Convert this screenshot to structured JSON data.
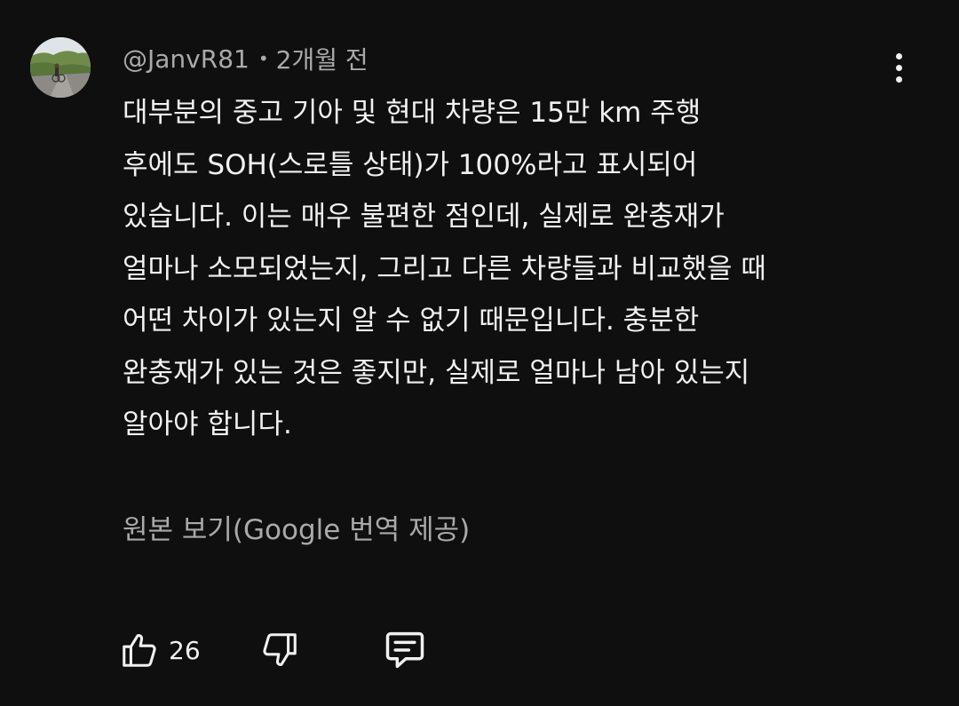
{
  "comment": {
    "author": "@JanvR81",
    "separator": "•",
    "time": "2개월 전",
    "lines": [
      "대부분의 중고 기아 및 현대 차량은 15만 km 주행",
      "후에도 SOH(스로틀 상태)가 100%라고 표시되어",
      "있습니다. 이는 매우 불편한 점인데, 실제로 완충재가",
      "얼마나 소모되었는지, 그리고 다른 차량들과 비교했을 때",
      "어떤 차이가 있는지 알 수 없기 때문입니다. 충분한",
      "완충재가 있는 것은 좋지만, 실제로 얼마나 남아 있는지",
      "알아야 합니다."
    ],
    "translation_link": "원본 보기(Google 번역 제공)",
    "like_count": "26"
  },
  "icons": {
    "avatar": "avatar-photo",
    "more": "more-vertical-icon",
    "like": "thumbs-up-icon",
    "dislike": "thumbs-down-icon",
    "reply": "comment-icon"
  },
  "colors": {
    "background": "#0f0f0f",
    "primary_text": "#f1f1f1",
    "secondary_text": "#aaaaaa"
  }
}
